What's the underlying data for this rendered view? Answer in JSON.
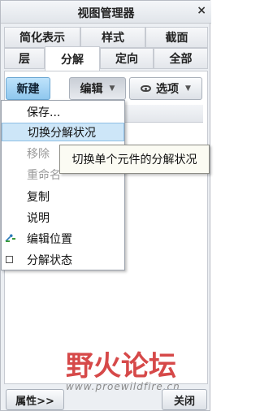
{
  "window": {
    "title": "视图管理器",
    "close_glyph": "×"
  },
  "tabs_row1": [
    "简化表示",
    "样式",
    "截面"
  ],
  "tabs_row2": [
    "层",
    "分解",
    "定向",
    "全部"
  ],
  "active_tab": "分解",
  "toolbar": {
    "new_label": "新建",
    "edit_label": "编辑",
    "options_label": "选项",
    "caret": "▼"
  },
  "menu": {
    "items": [
      {
        "label": "保存...",
        "state": "normal"
      },
      {
        "label": "切换分解状况",
        "state": "hover"
      },
      {
        "label": "移除",
        "state": "disabled"
      },
      {
        "label": "重命名",
        "state": "disabled"
      },
      {
        "label": "复制",
        "state": "normal"
      },
      {
        "label": "说明",
        "state": "normal"
      },
      {
        "label": "编辑位置",
        "state": "normal",
        "icon": "edit-position-icon"
      },
      {
        "label": "分解状态",
        "state": "normal",
        "icon": "checkbox-icon"
      }
    ]
  },
  "tooltip": {
    "text": "切换单个元件的分解状况"
  },
  "footer": {
    "properties_label": "属性>>",
    "close_label": "关闭"
  },
  "watermark": {
    "brand": "野火论坛",
    "url": "www.proewildfire.cn"
  },
  "colors": {
    "primary_button": "#8fc7ee",
    "hover_item": "#cde6f8",
    "watermark": "#cf2a2a"
  }
}
